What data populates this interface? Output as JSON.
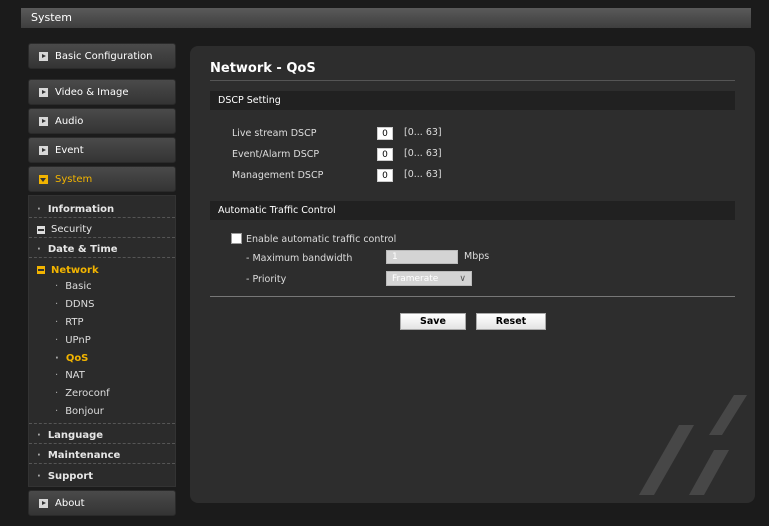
{
  "window": {
    "title": "System"
  },
  "sidebar": {
    "basic_configuration": "Basic Configuration",
    "video_image": "Video & Image",
    "audio": "Audio",
    "event": "Event",
    "system": "System",
    "about": "About",
    "system_items": {
      "information": "Information",
      "security": "Security",
      "date_time": "Date & Time",
      "network": "Network",
      "network_children": [
        "Basic",
        "DDNS",
        "RTP",
        "UPnP",
        "QoS",
        "NAT",
        "Zeroconf",
        "Bonjour"
      ],
      "language": "Language",
      "maintenance": "Maintenance",
      "support": "Support"
    }
  },
  "main": {
    "title": "Network - QoS",
    "dscp": {
      "header": "DSCP Setting",
      "rows": [
        {
          "label": "Live stream DSCP",
          "value": "0",
          "range": "[0... 63]"
        },
        {
          "label": "Event/Alarm DSCP",
          "value": "0",
          "range": "[0... 63]"
        },
        {
          "label": "Management DSCP",
          "value": "0",
          "range": "[0... 63]"
        }
      ]
    },
    "atc": {
      "header": "Automatic Traffic Control",
      "enable_label": "Enable automatic traffic control",
      "enable_checked": false,
      "max_bw_label": "- Maximum bandwidth",
      "max_bw_value": "1",
      "max_bw_unit": "Mbps",
      "priority_label": "- Priority",
      "priority_value": "Framerate"
    },
    "buttons": {
      "save": "Save",
      "reset": "Reset"
    }
  },
  "colors": {
    "accent": "#f2b400",
    "background": "#1b1b1b",
    "panel": "#2d2d2d"
  }
}
